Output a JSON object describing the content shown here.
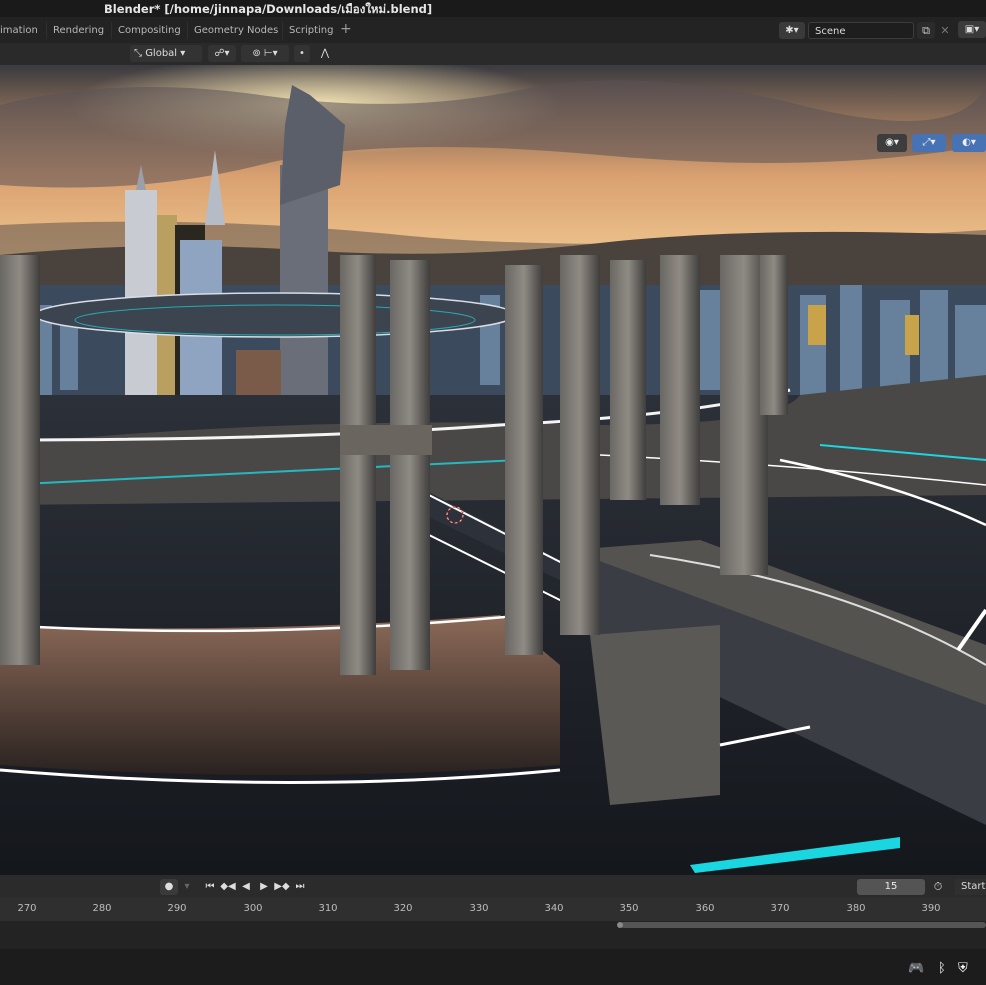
{
  "window": {
    "title": "Blender* [/home/jinnapa/Downloads/เมืองใหม่.blend]"
  },
  "workspace_tabs": [
    {
      "label": "imation"
    },
    {
      "label": "Rendering"
    },
    {
      "label": "Compositing"
    },
    {
      "label": "Geometry Nodes"
    },
    {
      "label": "Scripting"
    }
  ],
  "add_tab_label": "+",
  "scene": {
    "name": "Scene"
  },
  "toolbar": {
    "transform_orientation": "Global"
  },
  "timeline": {
    "current_frame": "15",
    "start_label": "Start",
    "ruler_ticks": [
      "270",
      "280",
      "290",
      "300",
      "310",
      "320",
      "330",
      "340",
      "350",
      "360",
      "370",
      "380",
      "390"
    ]
  },
  "icons": {
    "viewport_gizmos": [
      "visibility-icon",
      "gizmo-icon",
      "overlay-icon"
    ],
    "playback": [
      "record-icon",
      "jump-start-icon",
      "prev-keyframe-icon",
      "play-reverse-icon",
      "play-icon",
      "next-keyframe-icon",
      "jump-end-icon"
    ],
    "tray": [
      "discord-icon",
      "bluetooth-icon",
      "shield-icon"
    ]
  },
  "colors": {
    "accent_blue": "#4772b3",
    "neon_cyan": "#19d6e0",
    "background": "#1d1d1d"
  }
}
